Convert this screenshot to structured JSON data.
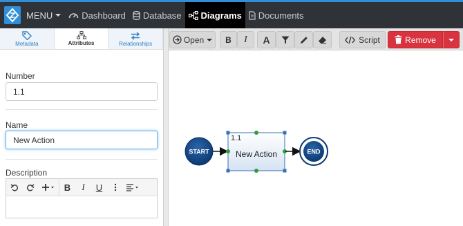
{
  "nav": {
    "menu_label": "MENU",
    "items": [
      {
        "label": "Dashboard",
        "icon": "dashboard-icon"
      },
      {
        "label": "Database",
        "icon": "database-icon"
      },
      {
        "label": "Diagrams",
        "icon": "diagram-icon",
        "active": true
      },
      {
        "label": "Documents",
        "icon": "document-icon"
      }
    ]
  },
  "panel": {
    "tabs": [
      {
        "label": "Metadata",
        "icon": "tag-icon"
      },
      {
        "label": "Attributes",
        "icon": "sitemap-icon",
        "active": true
      },
      {
        "label": "Relationships",
        "icon": "exchange-icon"
      }
    ],
    "number_label": "Number",
    "number_value": "1.1",
    "name_label": "Name",
    "name_value": "New Action",
    "description_label": "Description"
  },
  "toolbar": {
    "open_label": "Open",
    "bold": "B",
    "italic": "I",
    "font": "A",
    "script_label": "Script",
    "remove_label": "Remove"
  },
  "editor_toolbar": {
    "bold": "B",
    "italic": "I",
    "underline": "U"
  },
  "diagram": {
    "start_label": "START",
    "end_label": "END",
    "action_number": "1.1",
    "action_label": "New Action"
  },
  "colors": {
    "brand": "#2f8fd8",
    "nav_bg": "#2f3338",
    "danger": "#d9333f",
    "node_dark": "#0d3f7a",
    "selection": "#3a6fb8",
    "handle_green": "#2e9e3a"
  }
}
